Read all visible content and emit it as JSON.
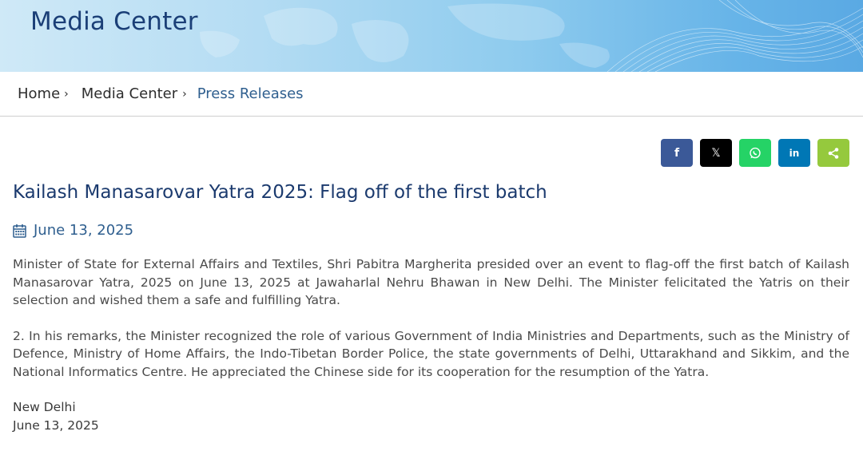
{
  "banner": {
    "title": "Media Center"
  },
  "breadcrumb": {
    "items": [
      {
        "label": "Home"
      },
      {
        "label": "Media Center"
      },
      {
        "label": "Press Releases"
      }
    ],
    "separator": "›"
  },
  "share": {
    "buttons": [
      {
        "icon": "facebook-icon",
        "glyph": "f",
        "color": "#3b5998"
      },
      {
        "icon": "x-icon",
        "glyph": "𝕏",
        "color": "#000000"
      },
      {
        "icon": "whatsapp-icon",
        "glyph": "",
        "color": "#25d366"
      },
      {
        "icon": "linkedin-icon",
        "glyph": "in",
        "color": "#0077b5"
      },
      {
        "icon": "share-icon",
        "glyph": "",
        "color": "#95c93d"
      }
    ]
  },
  "article": {
    "title": "Kailash Manasarovar Yatra 2025: Flag off of the first batch",
    "date": "June 13, 2025",
    "paragraphs": [
      "Minister of State for External Affairs and Textiles, Shri Pabitra Margherita presided over an event to flag-off the first batch of Kailash Manasarovar Yatra, 2025 on June 13, 2025 at Jawaharlal Nehru Bhawan in New Delhi. The Minister felicitated the Yatris on their selection and wished them a safe and fulfilling Yatra.",
      "2. In his remarks, the Minister recognized the role of various Government of India Ministries and Departments, such as the Ministry of Defence, Ministry of Home Affairs, the Indo-Tibetan Border Police, the state governments of Delhi, Uttarakhand and Sikkim, and the National Informatics Centre. He appreciated the Chinese side for its cooperation for the resumption of the Yatra."
    ],
    "place": "New Delhi",
    "signoff_date": "June 13, 2025"
  }
}
